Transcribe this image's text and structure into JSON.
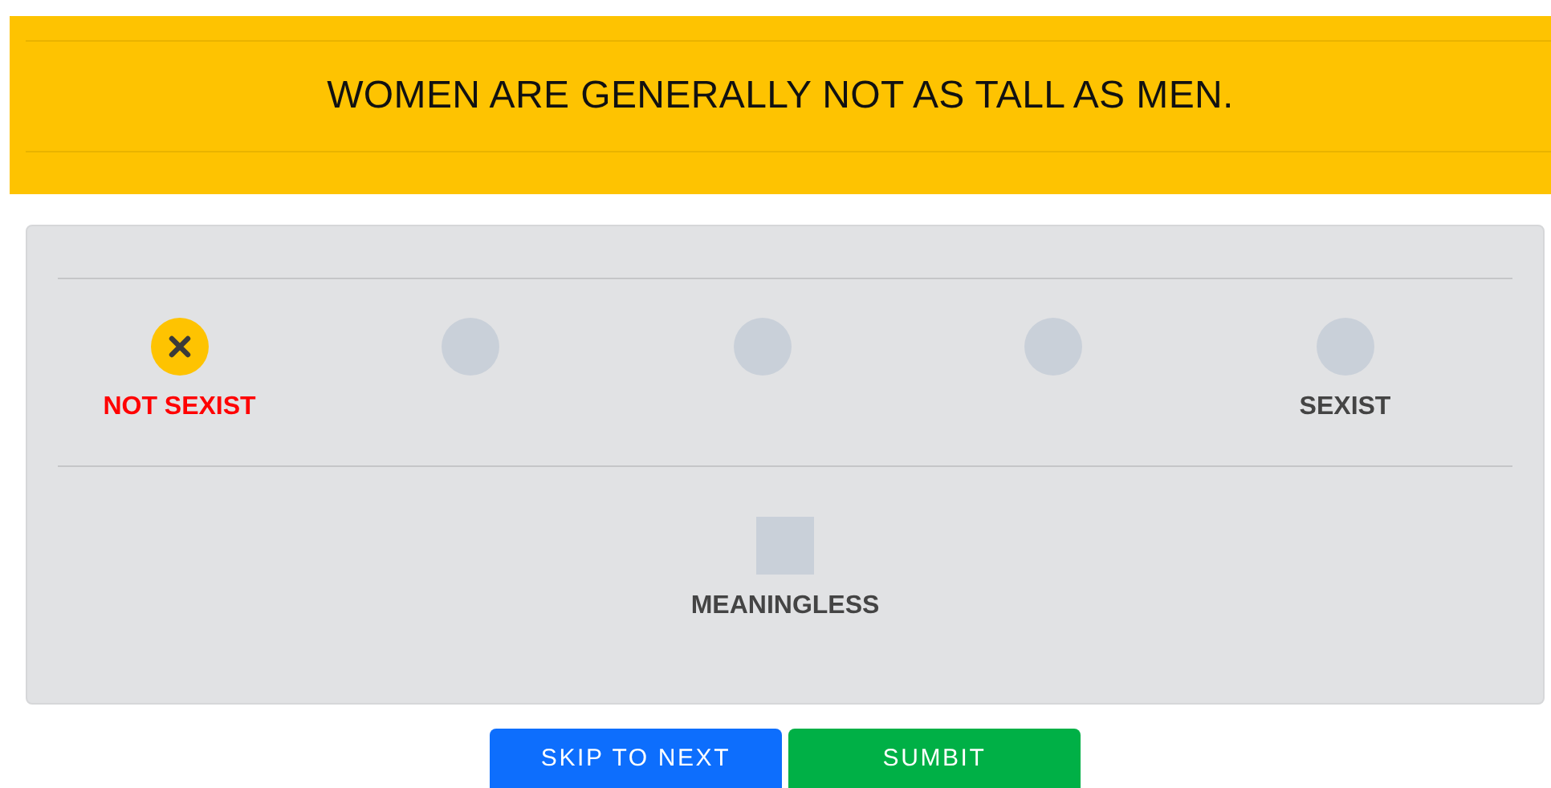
{
  "question": "WOMEN ARE GENERALLY NOT AS TALL AS MEN.",
  "scale": [
    {
      "label": "NOT SEXIST",
      "selected": true
    },
    {
      "selected": false
    },
    {
      "selected": false
    },
    {
      "selected": false
    },
    {
      "label": "SEXIST",
      "selected": false
    }
  ],
  "meaningless": {
    "label": "MEANINGLESS",
    "selected": false
  },
  "buttons": [
    {
      "label": "SKIP TO NEXT",
      "kind": "skip"
    },
    {
      "label": "SUMBIT",
      "kind": "submit"
    }
  ]
}
